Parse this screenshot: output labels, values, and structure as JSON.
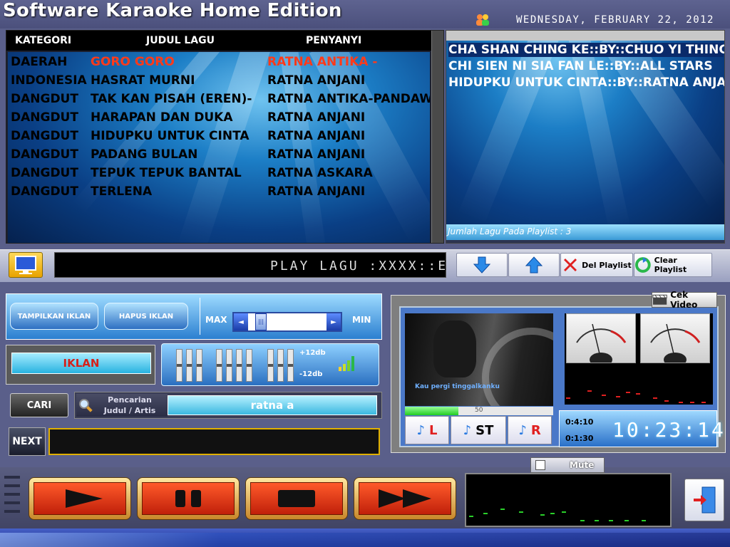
{
  "app": {
    "title": "Software Karaoke Home Edition",
    "date": "Wednesday, February 22, 2012"
  },
  "song_list": {
    "headers": {
      "kategori": "KATEGORI",
      "judul": "JUDUL LAGU",
      "penyanyi": "PENYANYI"
    },
    "rows": [
      {
        "kategori": "DAERAH",
        "judul": "GORO GORO",
        "penyanyi": "RATNA ANTIKA -"
      },
      {
        "kategori": "INDONESIA",
        "judul": "HASRAT MURNI",
        "penyanyi": "RATNA ANJANI"
      },
      {
        "kategori": "DANGDUT",
        "judul": "TAK KAN PISAH (EREN)-",
        "penyanyi": "RATNA ANTIKA-PANDAWA"
      },
      {
        "kategori": "DANGDUT",
        "judul": "HARAPAN DAN DUKA",
        "penyanyi": "RATNA ANJANI"
      },
      {
        "kategori": "DANGDUT",
        "judul": "HIDUPKU UNTUK CINTA",
        "penyanyi": "RATNA ANJANI"
      },
      {
        "kategori": "DANGDUT",
        "judul": "PADANG BULAN",
        "penyanyi": "RATNA ANJANI"
      },
      {
        "kategori": "DANGDUT",
        "judul": "TEPUK TEPUK BANTAL",
        "penyanyi": "RATNA ASKARA"
      },
      {
        "kategori": "DANGDUT",
        "judul": "TERLENA",
        "penyanyi": "RATNA ANJANI"
      }
    ]
  },
  "playlist": {
    "items": [
      "CHA SHAN CHING KE::BY::CHUO YI THING",
      "CHI SIEN NI SIA FAN LE::BY::ALL STARS",
      "HIDUPKU UNTUK CINTA::BY::RATNA ANJANI"
    ],
    "count_text": "Jumlah Lagu Pada Playlist : 3"
  },
  "marquee": {
    "text": "PLAY  LAGU :XXXX::E"
  },
  "toolbar": {
    "del_playlist": "Del Playlist",
    "clear_playlist": "Clear Playlist"
  },
  "iklan": {
    "tampilkan": "TAMPILKAN IKLAN",
    "hapus": "HAPUS IKLAN",
    "label": "IKLAN",
    "vol_max": "MAX",
    "vol_min": "MIN"
  },
  "eq": {
    "db_top": "+12db",
    "db_bottom": "-12db"
  },
  "search": {
    "cari": "CARI",
    "label_line1": "Pencarian",
    "label_line2": "Judul / Artis",
    "value": "ratna a"
  },
  "next": {
    "label": "NEXT"
  },
  "video": {
    "cek_video": "Cek Video",
    "lyric": "Kau pergi tinggalkanku",
    "progress_num": "50",
    "progress_fraction": 0.36,
    "ch_left": "L",
    "ch_stereo": "ST",
    "ch_right": "R",
    "time_total": "0:4:10",
    "time_elapsed": "0:1:30",
    "clock": "10:23:14"
  },
  "mute": {
    "label": "Mute"
  },
  "colors": {
    "accent_red": "#ff3a1a",
    "panel_blue": "#1c7ec6",
    "gold": "#e0b000"
  }
}
